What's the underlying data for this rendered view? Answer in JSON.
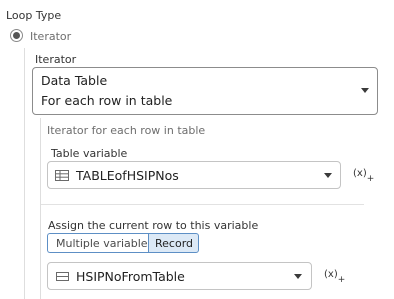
{
  "loop_type": {
    "label": "Loop Type",
    "option_label": "Iterator"
  },
  "iterator": {
    "label": "Iterator",
    "selected_title": "Data Table",
    "selected_subtitle": "For each row in table",
    "section_title": "Iterator for each row in table"
  },
  "table_variable": {
    "label": "Table variable",
    "value": "TABLEofHSIPNos",
    "icon": "table-icon",
    "fx_label": "(x)",
    "fx_sub": "+"
  },
  "assign": {
    "label": "Assign the current row to this variable",
    "toggle_multiple": "Multiple variables",
    "toggle_record": "Record",
    "value": "HSIPNoFromTable",
    "icon": "record-icon",
    "fx_label": "(x)",
    "fx_sub": "+"
  },
  "colors": {
    "accent_bg": "#dce9f6",
    "accent_border": "#5d8fc5",
    "radio": "#555555"
  }
}
